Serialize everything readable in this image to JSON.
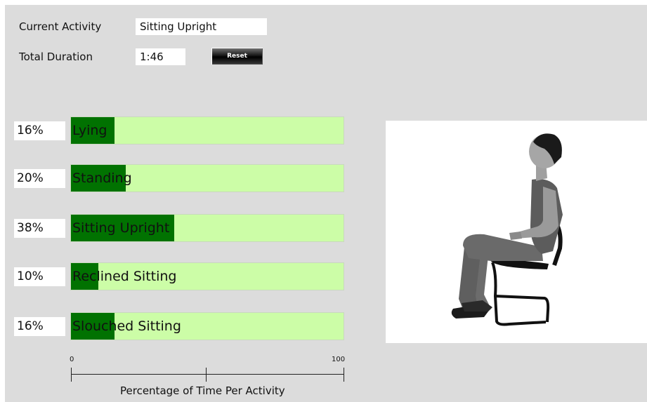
{
  "header": {
    "current_activity_label": "Current Activity",
    "current_activity_value": "Sitting Upright",
    "total_duration_label": "Total Duration",
    "total_duration_value": "1:46",
    "reset_label": "Reset"
  },
  "chart_data": {
    "type": "bar",
    "categories": [
      "Lying",
      "Standing",
      "Sitting Upright",
      "Reclined Sitting",
      "Slouched Sitting"
    ],
    "values": [
      16,
      20,
      38,
      10,
      16
    ],
    "percent_labels": [
      "16%",
      "20%",
      "38%",
      "10%",
      "16%"
    ],
    "xlabel": "Percentage of Time Per Activity",
    "xlim": [
      0,
      100
    ],
    "tick_labels": [
      "0",
      "100"
    ],
    "orientation": "horizontal",
    "colors": {
      "fill": "#017201",
      "track": "#ccfda7"
    }
  },
  "figure": {
    "icon": "person-sitting-upright-icon"
  }
}
